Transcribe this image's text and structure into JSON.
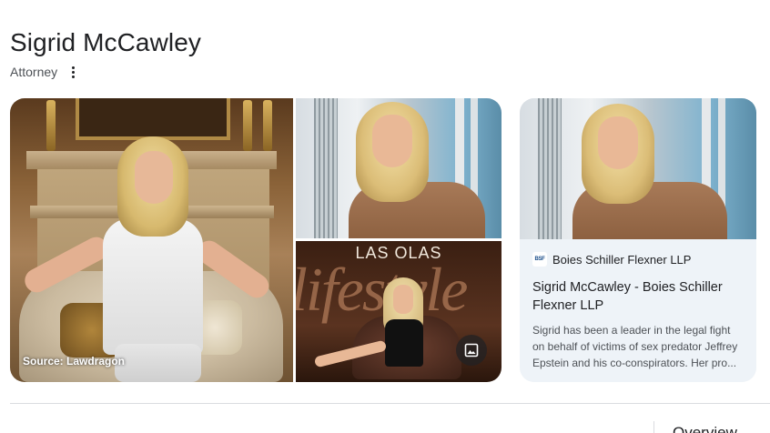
{
  "header": {
    "title": "Sigrid McCawley",
    "subtitle": "Attorney"
  },
  "images": {
    "main_source": "Source: Lawdragon",
    "magazine_title_top": "LAS OLAS",
    "magazine_title_big": "lifestyle"
  },
  "card": {
    "favicon_text": "BSF",
    "source_name": "Boies Schiller Flexner LLP",
    "title": "Sigrid McCawley - Boies Schiller Flexner LLP",
    "snippet": "Sigrid has been a leader in the legal fight on behalf of victims of sex predator Jeffrey Epstein and his co-conspirators. Her pro..."
  },
  "tabs": {
    "overview": "Overview"
  },
  "icons": [
    "more-vert-icon",
    "image-icon"
  ]
}
